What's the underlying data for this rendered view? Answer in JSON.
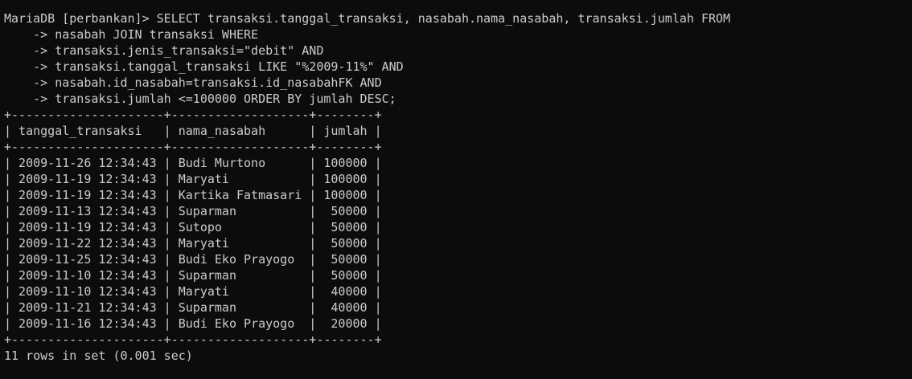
{
  "prompt": "MariaDB [perbankan]> ",
  "query_lines": [
    "SELECT transaksi.tanggal_transaksi, nasabah.nama_nasabah, transaksi.jumlah FROM",
    "    -> nasabah JOIN transaksi WHERE",
    "    -> transaksi.jenis_transaksi=\"debit\" AND",
    "    -> transaksi.tanggal_transaksi LIKE \"%2009-11%\" AND",
    "    -> nasabah.id_nasabah=transaksi.id_nasabahFK AND",
    "    -> transaksi.jumlah <=100000 ORDER BY jumlah DESC;"
  ],
  "table": {
    "border": "+---------------------+-------------------+--------+",
    "header": "| tanggal_transaksi   | nama_nasabah      | jumlah |",
    "rows": [
      "| 2009-11-26 12:34:43 | Budi Murtono      | 100000 |",
      "| 2009-11-19 12:34:43 | Maryati           | 100000 |",
      "| 2009-11-19 12:34:43 | Kartika Fatmasari | 100000 |",
      "| 2009-11-13 12:34:43 | Suparman          |  50000 |",
      "| 2009-11-19 12:34:43 | Sutopo            |  50000 |",
      "| 2009-11-22 12:34:43 | Maryati           |  50000 |",
      "| 2009-11-25 12:34:43 | Budi Eko Prayogo  |  50000 |",
      "| 2009-11-10 12:34:43 | Suparman          |  50000 |",
      "| 2009-11-10 12:34:43 | Maryati           |  40000 |",
      "| 2009-11-21 12:34:43 | Suparman          |  40000 |",
      "| 2009-11-16 12:34:43 | Budi Eko Prayogo  |  20000 |"
    ]
  },
  "result_summary": "11 rows in set (0.001 sec)",
  "colors": {
    "background": "#0c0c0c",
    "foreground": "#cccccc"
  }
}
